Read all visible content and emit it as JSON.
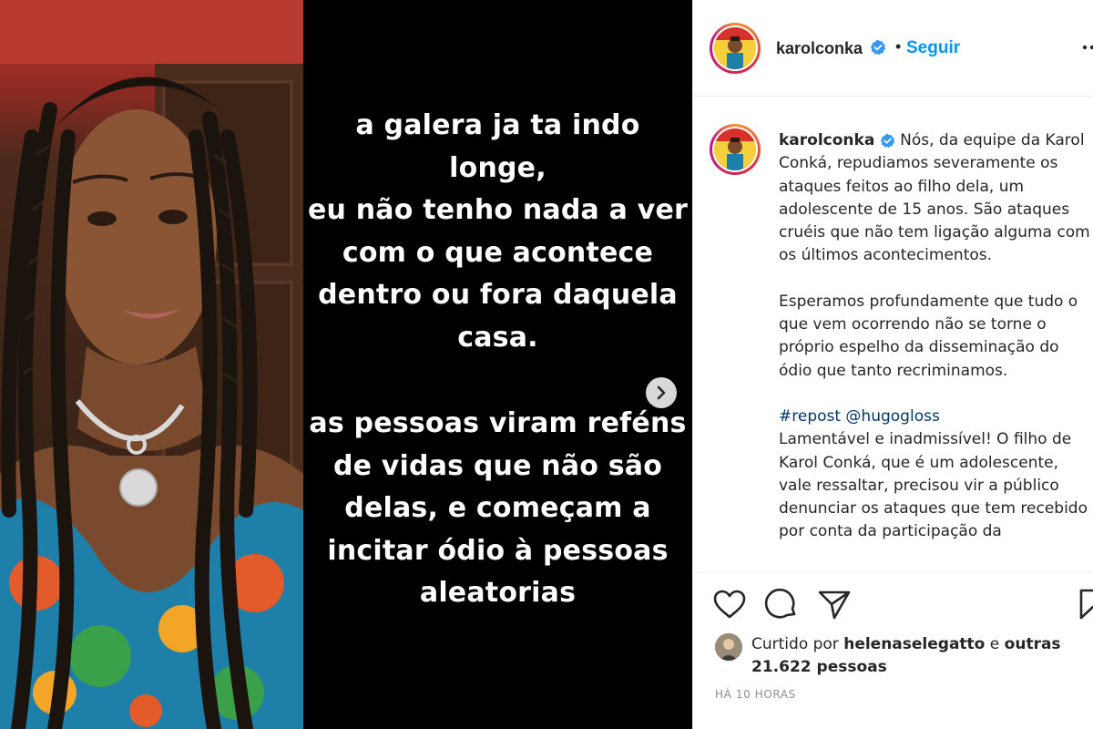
{
  "post": {
    "username": "karolconka",
    "follow_label": "Seguir",
    "separator": "•",
    "story": {
      "block1": [
        "a galera ja ta indo longe,",
        "eu não tenho nada a ver",
        "com o que acontece",
        "dentro ou fora daquela",
        "casa."
      ],
      "block2": [
        "as pessoas viram reféns",
        "de vidas que não são",
        "delas, e começam a",
        "incitar ódio à pessoas",
        "aleatorias"
      ]
    },
    "caption": {
      "username": "karolconka",
      "paragraph1": "Nós, da equipe da Karol Conká, repudiamos severamente os ataques feitos ao filho dela, um adolescente de 15 anos. São ataques cruéis que não tem ligação alguma com os últimos acontecimentos.",
      "paragraph2": "Esperamos profundamente que tudo o que vem ocorrendo não se torne o próprio espelho da disseminação do ódio que tanto recriminamos.",
      "repost_tag": "#repost @hugogloss",
      "paragraph3": "Lamentável e inadmissível! O filho de Karol Conká, que é um adolescente, vale ressaltar, precisou vir a público denunciar os ataques que tem recebido por conta da participação da"
    },
    "likes": {
      "prefix": "Curtido por",
      "liker": "helenaselegatto",
      "connector": "e",
      "others": "outras 21.622 pessoas"
    },
    "timestamp": "HÁ 10 HORAS"
  },
  "icons": {
    "verified": "verified-badge-icon",
    "more": "more-options-icon",
    "like": "heart-icon",
    "comment": "comment-icon",
    "share": "paper-plane-icon",
    "save": "bookmark-icon",
    "next": "chevron-right-icon"
  },
  "colors": {
    "link_blue": "#0095f6",
    "verified_blue": "#3897f0",
    "hashtag": "#00376b",
    "muted": "#8e8e8e",
    "text": "#262626"
  }
}
